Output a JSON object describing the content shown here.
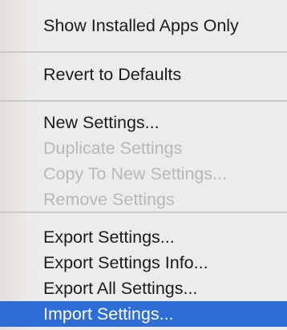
{
  "menu": {
    "groups": [
      {
        "items": [
          {
            "label": "Show Installed Apps Only",
            "enabled": true,
            "selected": false
          }
        ]
      },
      {
        "items": [
          {
            "label": "Revert to Defaults",
            "enabled": true,
            "selected": false
          }
        ]
      },
      {
        "items": [
          {
            "label": "New Settings...",
            "enabled": true,
            "selected": false
          },
          {
            "label": "Duplicate Settings",
            "enabled": false,
            "selected": false
          },
          {
            "label": "Copy To New Settings...",
            "enabled": false,
            "selected": false
          },
          {
            "label": "Remove Settings",
            "enabled": false,
            "selected": false
          }
        ]
      },
      {
        "items": [
          {
            "label": "Export Settings...",
            "enabled": true,
            "selected": false
          },
          {
            "label": "Export Settings Info...",
            "enabled": true,
            "selected": false
          },
          {
            "label": "Export All Settings...",
            "enabled": true,
            "selected": false
          },
          {
            "label": "Import Settings...",
            "enabled": true,
            "selected": true
          }
        ]
      }
    ]
  },
  "colors": {
    "highlight": "#2d6dd6",
    "text": "#1b1b1b",
    "disabled_text": "#b8b8b8",
    "menu_background": "#ececec"
  }
}
